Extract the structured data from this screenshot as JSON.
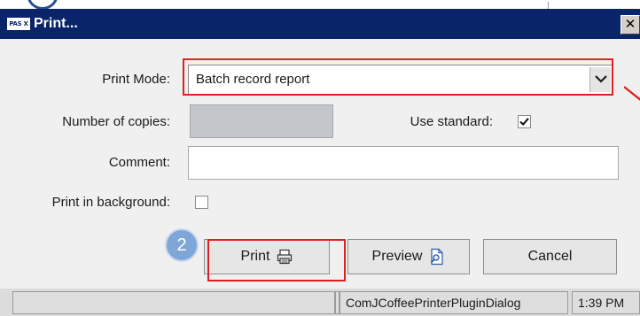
{
  "window": {
    "app_logo_text": "PAS X",
    "title": "Print...",
    "close_label": "✕"
  },
  "form": {
    "print_mode_label": "Print Mode:",
    "print_mode_value": "Batch record report",
    "copies_label": "Number of copies:",
    "copies_value": "",
    "use_standard_label": "Use standard:",
    "use_standard_checked": true,
    "comment_label": "Comment:",
    "comment_value": "",
    "background_label": "Print in background:",
    "background_checked": false
  },
  "buttons": {
    "print_label": "Print",
    "preview_label": "Preview",
    "cancel_label": "Cancel"
  },
  "annotation": {
    "step_number": "2",
    "highlight_color": "#e02020"
  },
  "status_bar": {
    "segment_1": "",
    "segment_2": "",
    "plugin_name": "ComJCoffeePrinterPluginDialog",
    "time": "1:39 PM"
  },
  "colors": {
    "titlebar": "#0a246a",
    "dialog_bg": "#f0f0f0",
    "badge": "#7fa6d9"
  }
}
